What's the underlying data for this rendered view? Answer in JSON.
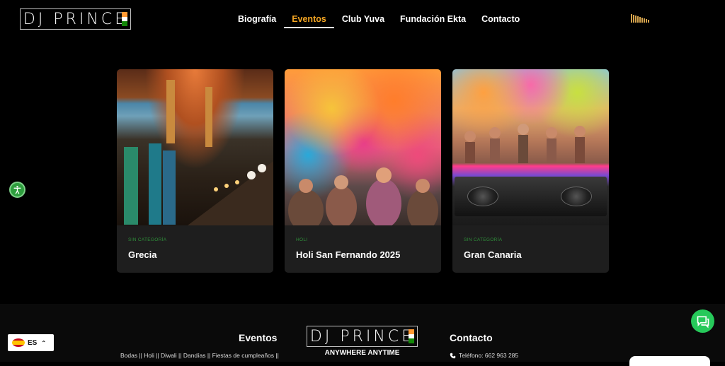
{
  "header": {
    "logo_text": "DJ PRINCE",
    "nav": [
      {
        "label": "Biografía",
        "active": false
      },
      {
        "label": "Eventos",
        "active": true
      },
      {
        "label": "Club Yuva",
        "active": false
      },
      {
        "label": "Fundación Ekta",
        "active": false
      },
      {
        "label": "Contacto",
        "active": false
      }
    ],
    "icons": {
      "audio": "audio-wave-icon"
    }
  },
  "accessibility": {
    "icon": "accessibility-icon"
  },
  "cards": [
    {
      "category": "Sin categoría",
      "title": "Grecia"
    },
    {
      "category": "Holi",
      "title": "Holi San Fernando 2025"
    },
    {
      "category": "Sin categoría",
      "title": "Gran Canaria"
    }
  ],
  "footer": {
    "eventos_heading": "Eventos",
    "eventos_text": "Bodas || Holi || Diwali || Dandías || Fiestas de cumpleaños ||",
    "logo_text": "DJ PRINCE",
    "tagline": "ANYWHERE ANYTIME",
    "contact_heading": "Contacto",
    "phone": "Teléfono: 662 963 285"
  },
  "language": {
    "code": "ES"
  },
  "colors": {
    "accent": "#f5a623",
    "category": "#2f8f3a",
    "card_bg": "#1e1e1e",
    "chat": "#26c95a"
  }
}
